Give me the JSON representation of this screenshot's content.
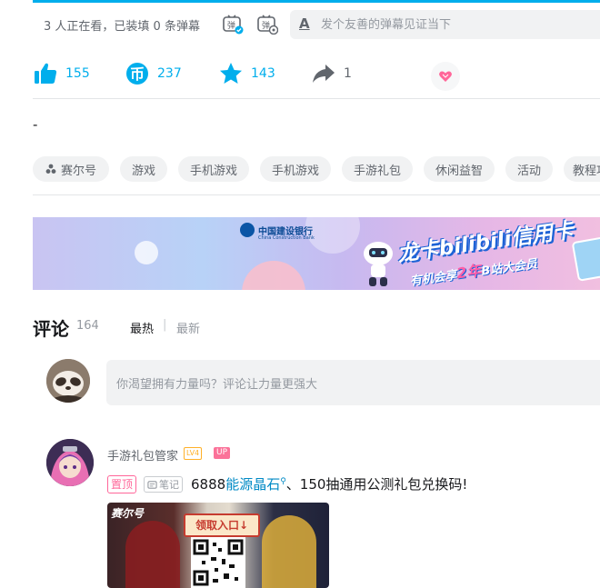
{
  "danmaku_bar": {
    "viewers_text": "3 人正在看，已装填 0 条弹幕",
    "toggle_on_icon": "danmaku-on-icon",
    "settings_icon": "danmaku-settings-icon",
    "input_placeholder": "发个友善的弹幕见证当下",
    "style_icon_glyph": "A"
  },
  "toolbar": {
    "like_count": "155",
    "coin_count": "237",
    "favorite_count": "143",
    "share_count": "1",
    "accent_color": "#00aeec"
  },
  "description": "-",
  "tags": [
    "赛尔号",
    "游戏",
    "手机游戏",
    "手机游戏",
    "手游礼包",
    "休闲益智",
    "活动",
    "教程攻"
  ],
  "banner": {
    "bank_name": "中国建设银行",
    "bank_name_en": "China Construction Bank",
    "title": "龙卡bilibili信用卡",
    "subtitle_prefix": "有机会享",
    "subtitle_highlight": "2年",
    "subtitle_suffix": "B站大会员"
  },
  "comments": {
    "title": "评论",
    "count": "164",
    "sort_hot": "最热",
    "sort_sep": "|",
    "sort_new": "最新",
    "input_placeholder": "你渴望拥有力量吗？评论让力量更强大",
    "items": [
      {
        "user_name": "手游礼包管家",
        "level": "LV4",
        "up_badge": "UP",
        "pinned_label": "置顶",
        "note_label": "笔记",
        "text_prefix": "6888",
        "text_link": "能源晶石",
        "text_suffix": "、150抽通用公测礼包兑换码!",
        "image": {
          "brand": "赛尔号",
          "claim_label": "领取入口↓"
        }
      }
    ]
  }
}
